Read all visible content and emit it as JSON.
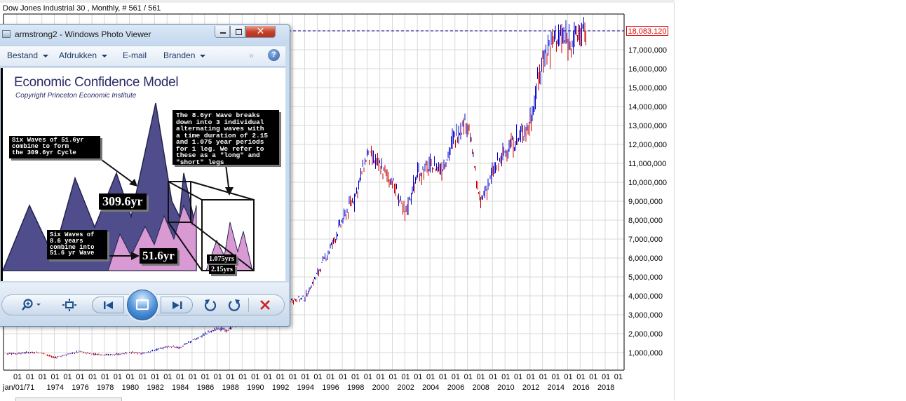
{
  "chart": {
    "title": "Dow Jones Industrial 30 , Monthly, # 561 / 561",
    "current_value_label": "18,083.120",
    "y_axis_labels": [
      "18,000,000",
      "17,000,000",
      "16,000,000",
      "15,000,000",
      "14,000,000",
      "13,000,000",
      "12,000,000",
      "11,000,000",
      "10,000,000",
      "9,000,000",
      "8,000,000",
      "7,000,000",
      "6,000,000",
      "5,000,000",
      "4,000,000",
      "3,000,000",
      "2,000,000",
      "1,000,000"
    ],
    "x_month_label": "01",
    "x_first_label": "jan/01/71",
    "x_year_labels": [
      "1974",
      "1976",
      "1978",
      "1980",
      "1982",
      "1984",
      "1986",
      "1988",
      "1990",
      "1992",
      "1994",
      "1996",
      "1998",
      "2000",
      "2002",
      "2004",
      "2006",
      "2008",
      "2010",
      "2012",
      "2014",
      "2016",
      "2018"
    ],
    "colors": {
      "up_bar": "#0000cc",
      "down_bar": "#cc0000",
      "grid": "#d9d9d9",
      "ref_line": "#00008b",
      "price_tag": "#dd0000"
    }
  },
  "chart_data": {
    "type": "bar",
    "series": [
      {
        "name": "",
        "x": [
          1971,
          1972,
          1973,
          1974,
          1975,
          1976,
          1977,
          1978,
          1979,
          1980,
          1981,
          1982,
          1983,
          1984,
          1985,
          1986,
          1987,
          1988,
          1989,
          1990,
          1991,
          1992,
          1993,
          1994,
          1995,
          1996,
          1997,
          1998,
          1999,
          2000,
          2001,
          2002,
          2003,
          2004,
          2005,
          2006,
          2007,
          2008,
          2009,
          2010,
          2011,
          2012,
          2013,
          2014,
          2015,
          2016
        ],
        "values": [
          0.88,
          0.95,
          0.92,
          0.66,
          0.83,
          0.99,
          0.86,
          0.82,
          0.83,
          0.95,
          0.88,
          1.05,
          1.25,
          1.2,
          1.55,
          1.9,
          2.2,
          2.15,
          2.7,
          2.6,
          3.15,
          3.3,
          3.75,
          3.8,
          5.1,
          6.4,
          7.9,
          9.2,
          11.4,
          10.8,
          10.0,
          8.3,
          10.4,
          10.8,
          10.7,
          12.4,
          13.3,
          8.8,
          10.4,
          11.6,
          12.2,
          13.1,
          16.5,
          17.8,
          17.4,
          17.9
        ]
      }
    ],
    "xlim": [
      1971,
      2019
    ],
    "ylim": [
      0,
      18.5
    ],
    "grid": true
  },
  "viewer": {
    "title": "armstrong2 - Windows Photo Viewer",
    "close_glyph": "✕",
    "menu": [
      "Bestand",
      "Afdrukken",
      "E-mail",
      "Branden"
    ],
    "more_glyph": "»",
    "help_glyph": "?",
    "image": {
      "title": "Economic Confidence Model",
      "copyright": "Copyright Princeton Economic Institute",
      "box_six_waves": "Six Waves of 51.6yr\ncombine to form\nthe 309.6yr Cycle",
      "box_breakdown": "The 8.6yr Wave breaks\ndown into 3 individual\nalternating waves with\na time duration of 2.15\nand 1.075 year periods\nfor 1 leg. We refer to\nthese as a \"long\" and\n\"short\" legs",
      "box_eight": "Six Waves of\n8.6 years\ncombine into\n51.6 yr Wave",
      "label_309": "309.6yr",
      "label_51": "51.6yr",
      "label_1075": "1.075yrs",
      "label_215": "2.15yrs"
    }
  }
}
